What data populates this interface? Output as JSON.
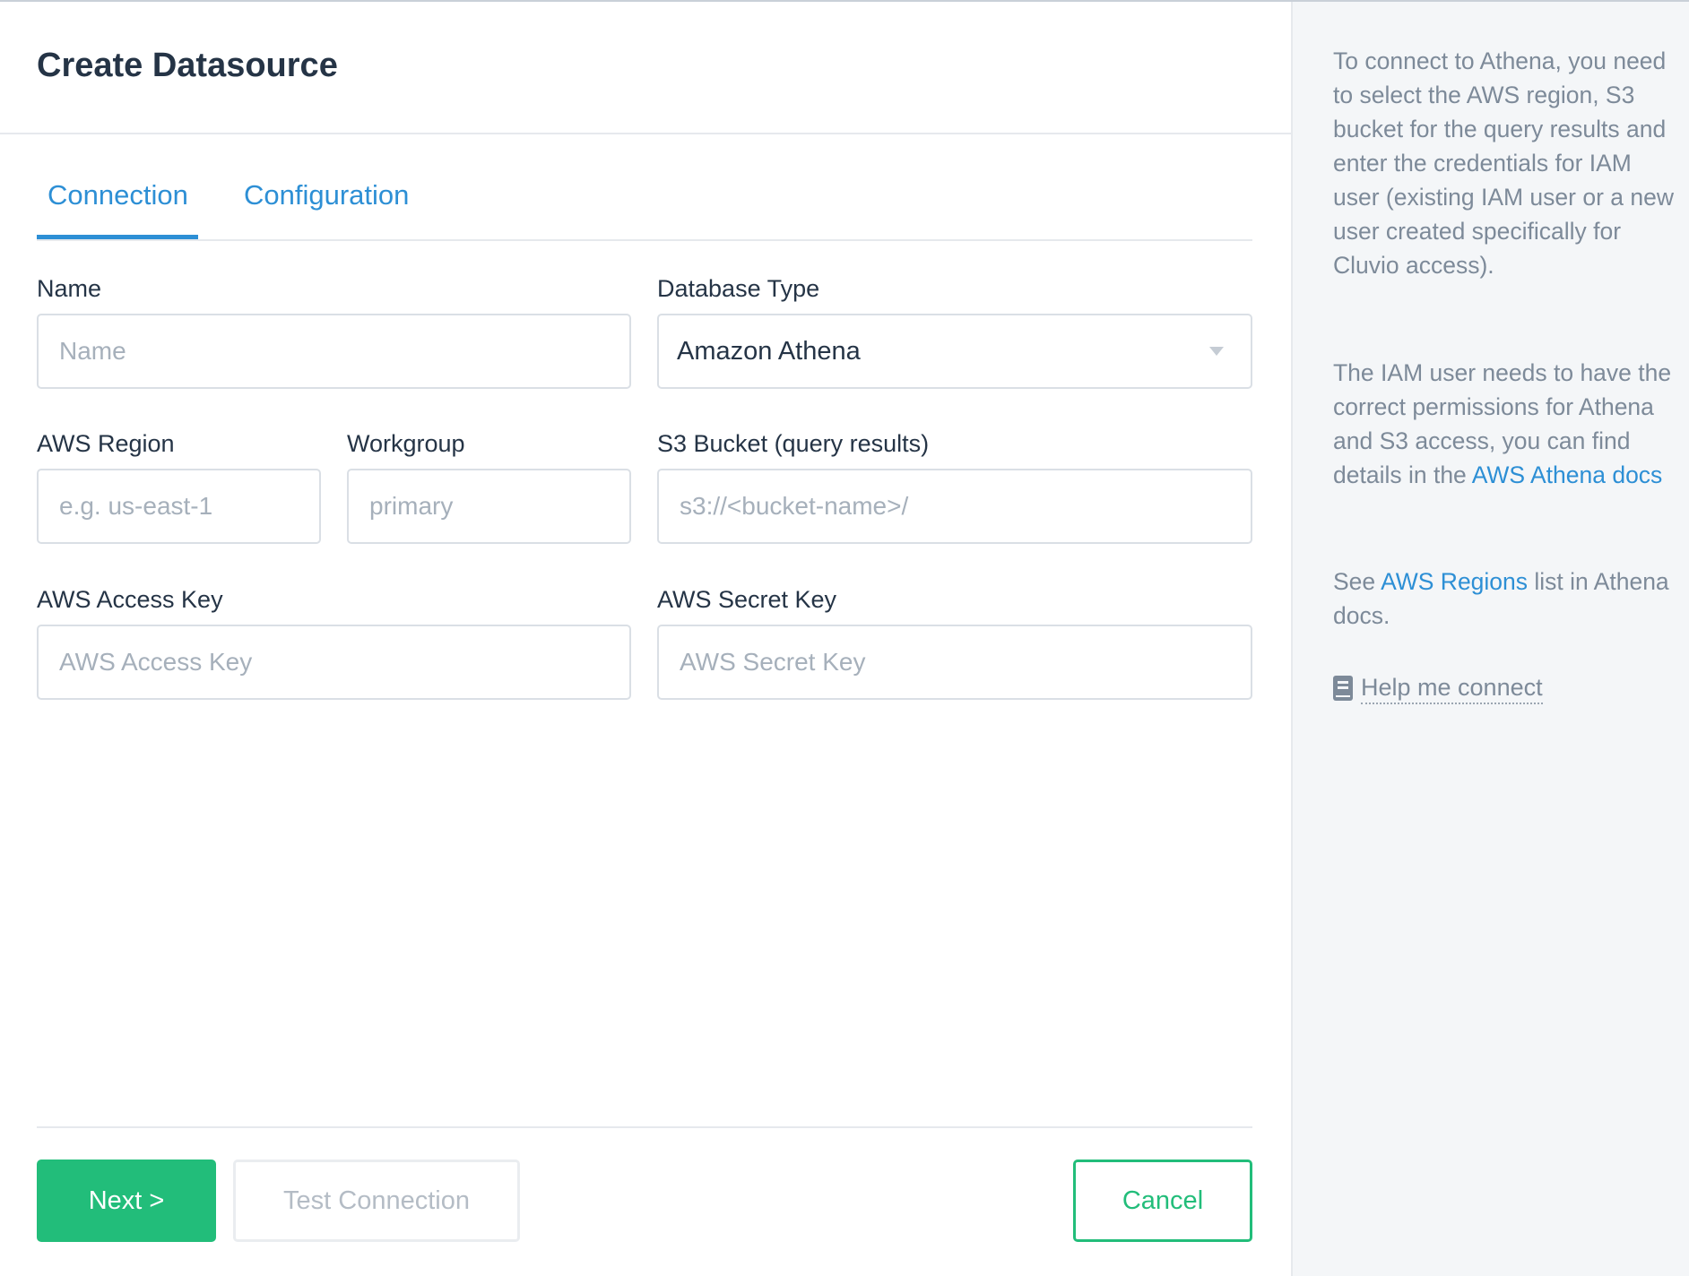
{
  "page": {
    "title": "Create Datasource"
  },
  "tabs": [
    {
      "label": "Connection",
      "active": true
    },
    {
      "label": "Configuration",
      "active": false
    }
  ],
  "form": {
    "name": {
      "label": "Name",
      "placeholder": "Name",
      "value": ""
    },
    "database_type": {
      "label": "Database Type",
      "value": "Amazon Athena"
    },
    "aws_region": {
      "label": "AWS Region",
      "placeholder": "e.g. us-east-1",
      "value": ""
    },
    "workgroup": {
      "label": "Workgroup",
      "placeholder": "primary",
      "value": ""
    },
    "s3_bucket": {
      "label": "S3 Bucket (query results)",
      "placeholder": "s3://<bucket-name>/",
      "value": ""
    },
    "aws_access_key": {
      "label": "AWS Access Key",
      "placeholder": "AWS Access Key",
      "value": ""
    },
    "aws_secret_key": {
      "label": "AWS Secret Key",
      "placeholder": "AWS Secret Key",
      "value": ""
    }
  },
  "buttons": {
    "next": "Next >",
    "test_connection": "Test Connection",
    "cancel": "Cancel"
  },
  "help": {
    "para1": "To connect to Athena, you need to select the AWS region, S3 bucket for the query results and enter the credentials for IAM user (existing IAM user or a new user created specifically for Cluvio access).",
    "para2_text": "The IAM user needs to have the correct permissions for Athena and S3 access, you can find details in the",
    "para2_link": "AWS Athena docs",
    "para3_prefix": "See",
    "para3_link": "AWS Regions",
    "para3_suffix": "list in Athena docs.",
    "connect_label": "Help me connect",
    "connect_icon": "book-icon"
  },
  "colors": {
    "accent_blue": "#2d8fd5",
    "primary_green": "#22bd7a",
    "heading_text": "#253446",
    "muted_text": "#7d8a99",
    "sidebar_bg": "#f4f6f8"
  }
}
